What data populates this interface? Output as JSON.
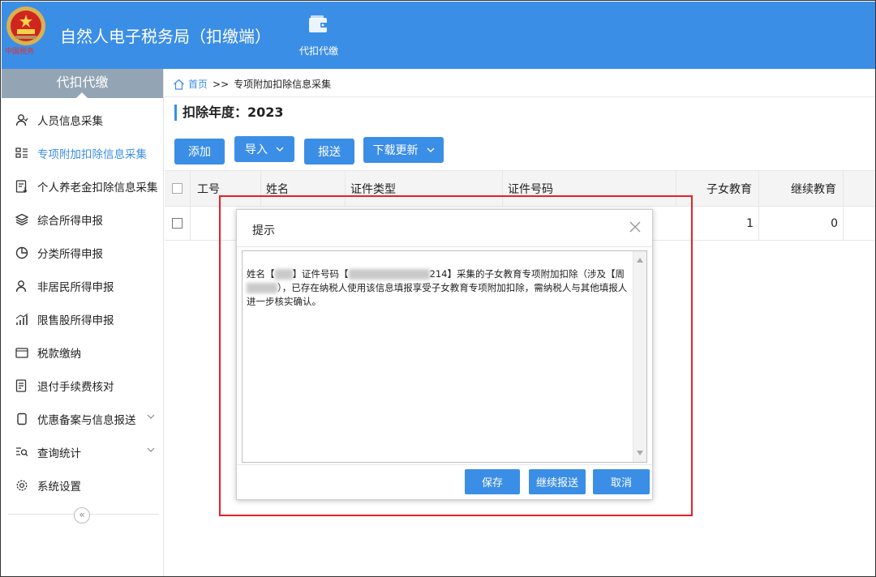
{
  "header": {
    "app_title": "自然人电子税务局（扣缴端）",
    "emblem_text": "中国税务",
    "nav_tile_label": "代扣代缴"
  },
  "sidebar": {
    "heading": "代扣代缴",
    "items": [
      {
        "label": "人员信息采集",
        "icon": "person-icon"
      },
      {
        "label": "专项附加扣除信息采集",
        "icon": "list-icon",
        "active": true
      },
      {
        "label": "个人养老金扣除信息采集",
        "icon": "document-download-icon"
      },
      {
        "label": "综合所得申报",
        "icon": "layers-icon"
      },
      {
        "label": "分类所得申报",
        "icon": "pie-chart-icon"
      },
      {
        "label": "非居民所得申报",
        "icon": "person-outline-icon"
      },
      {
        "label": "限售股所得申报",
        "icon": "bar-signal-icon"
      },
      {
        "label": "税款缴纳",
        "icon": "folder-icon"
      },
      {
        "label": "退付手续费核对",
        "icon": "doc-check-icon"
      },
      {
        "label": "优惠备案与信息报送",
        "icon": "copy-icon",
        "expandable": true
      },
      {
        "label": "查询统计",
        "icon": "search-list-icon",
        "expandable": true
      },
      {
        "label": "系统设置",
        "icon": "gear-icon"
      }
    ],
    "collapse_label": "«"
  },
  "breadcrumb": {
    "home": "首页",
    "separator": ">>",
    "current": "专项附加扣除信息采集"
  },
  "year_label": "扣除年度：2023",
  "toolbar": {
    "add": "添加",
    "import": "导入",
    "submit": "报送",
    "download": "下载更新"
  },
  "table": {
    "columns": [
      "工号",
      "姓名",
      "证件类型",
      "证件号码",
      "子女教育",
      "继续教育"
    ],
    "rows": [
      {
        "child_education": "1",
        "continuing_education": "0"
      }
    ]
  },
  "dialog": {
    "title": "提示",
    "msg_1": "姓名【",
    "msg_2": "】证件号码【",
    "msg_3": "214】采集的子女教育专项附加扣除（涉及【周",
    "msg_4": "），已存在纳税人使用该信息填报享受子女教育专项附加扣除，需纳税人与其他填报人进一步核实确认。",
    "save": "保存",
    "continue": "继续报送",
    "cancel": "取消"
  },
  "colors": {
    "accent": "#3b8ee6",
    "sidebar_head": "#93a5b4",
    "highlight": "#e8202a"
  }
}
